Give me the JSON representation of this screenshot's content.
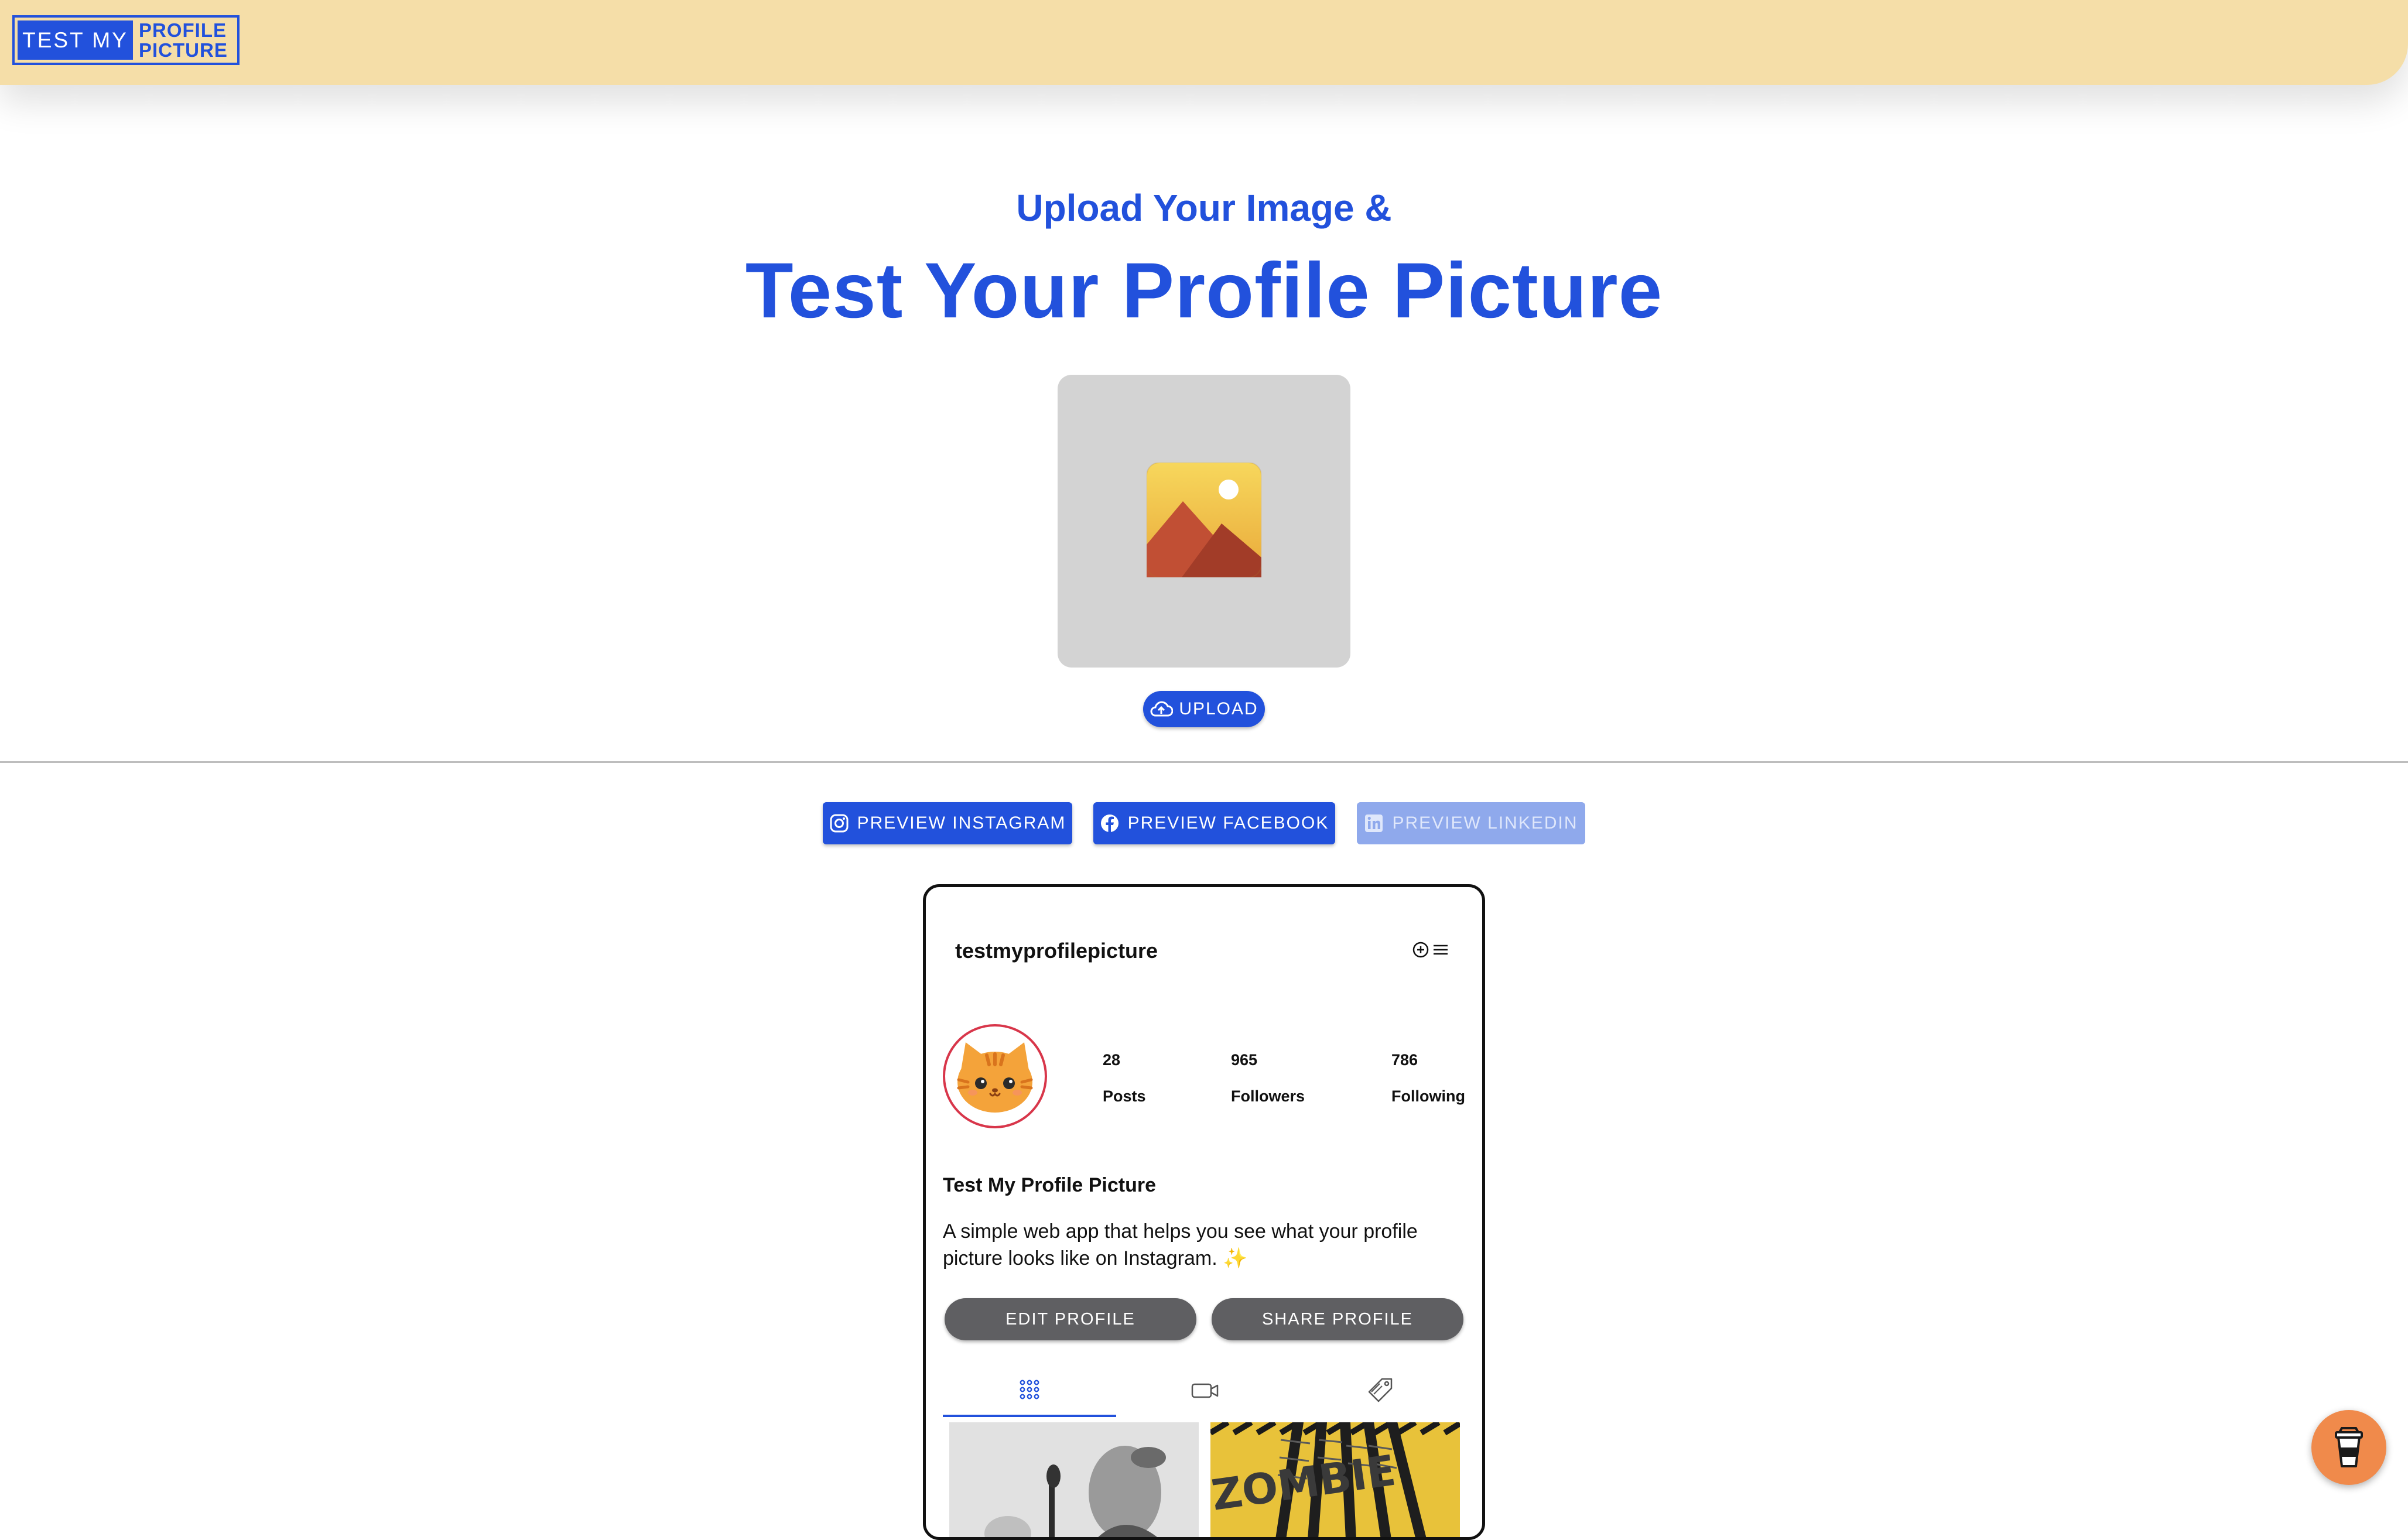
{
  "header": {
    "logo_left": "TEST MY",
    "logo_right_line1": "PROFILE",
    "logo_right_line2": "PICTURE"
  },
  "hero": {
    "subtitle": "Upload Your Image &",
    "title": "Test Your Profile Picture",
    "upload_icon": "image-placeholder-icon",
    "upload_label": "UPLOAD"
  },
  "preview_buttons": [
    {
      "label": "PREVIEW INSTAGRAM",
      "icon": "instagram-icon",
      "enabled": true
    },
    {
      "label": "PREVIEW FACEBOOK",
      "icon": "facebook-icon",
      "enabled": true
    },
    {
      "label": "PREVIEW LINKEDIN",
      "icon": "linkedin-icon",
      "enabled": false
    }
  ],
  "profile": {
    "username": "testmyprofilepicture",
    "stats": [
      {
        "value": "28",
        "label": "Posts"
      },
      {
        "value": "965",
        "label": "Followers"
      },
      {
        "value": "786",
        "label": "Following"
      }
    ],
    "display_name": "Test My Profile Picture",
    "bio": "A simple web app that helps you see what your profile picture looks like on Instagram. ✨",
    "edit_label": "EDIT PROFILE",
    "share_label": "SHARE PROFILE",
    "tabs": [
      "grid-icon",
      "video-icon",
      "tag-icon"
    ],
    "posts": [
      "post-thumbnail-singer",
      "post-thumbnail-zombie"
    ],
    "thumbnail_text": "ZOMBIE"
  },
  "colors": {
    "primary": "#2251dc",
    "header_bg": "#f5dea8",
    "button_gray": "#5f5f62",
    "fab": "#f08a4b"
  },
  "floating_button_icon": "coffee-cup-icon"
}
